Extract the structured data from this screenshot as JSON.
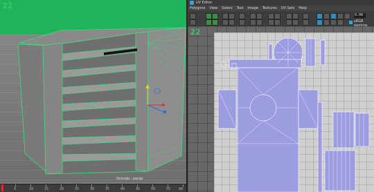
{
  "viewport": {
    "label": "22",
    "caption": "Outside : persp",
    "timeline": [
      {
        "n": "5"
      },
      {
        "n": "10"
      },
      {
        "n": "15"
      },
      {
        "n": "20"
      },
      {
        "n": "25"
      },
      {
        "n": "30"
      },
      {
        "n": "35"
      },
      {
        "n": "40"
      },
      {
        "n": "45"
      },
      {
        "n": "50"
      },
      {
        "n": "55"
      },
      {
        "n": "60"
      }
    ]
  },
  "uv_editor": {
    "title": "UV Editor",
    "menu": [
      "Polygons",
      "View",
      "Select",
      "Tool",
      "Image",
      "Textures",
      "UV Sets",
      "Help"
    ],
    "field_value": "0.00",
    "gamma_label": "sRGB gamma",
    "label": "22"
  },
  "colors": {
    "wire_green": "#39e27a",
    "uv_fill": "#9c9ce0",
    "uv_line": "#ffffff",
    "viewport_top": "#20b45a"
  }
}
